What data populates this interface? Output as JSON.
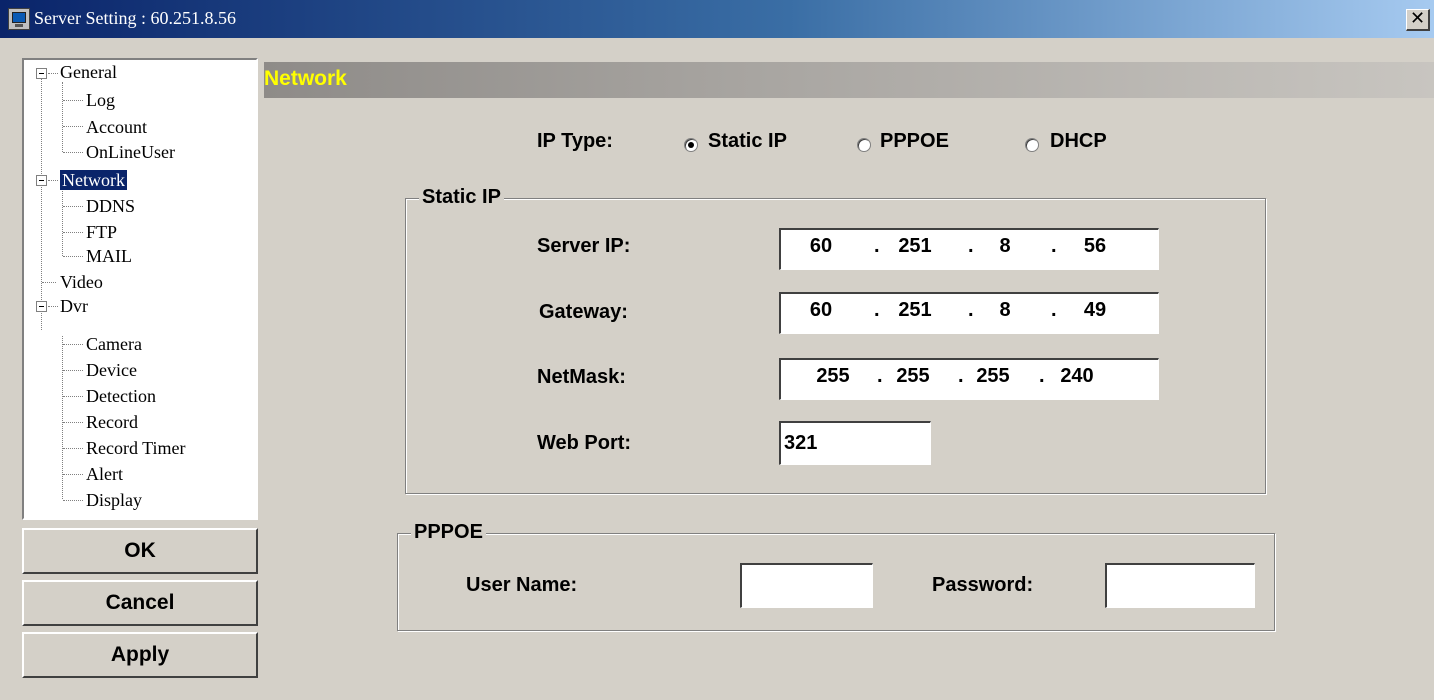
{
  "window": {
    "title": "Server Setting : 60.251.8.56",
    "close_glyph": "✕"
  },
  "tree": {
    "items": [
      {
        "label": "General",
        "level": 0,
        "expander": "minus"
      },
      {
        "label": "Log",
        "level": 1
      },
      {
        "label": "Account",
        "level": 1
      },
      {
        "label": "OnLineUser",
        "level": 1
      },
      {
        "label": "Network",
        "level": 0,
        "expander": "minus",
        "selected": true
      },
      {
        "label": "DDNS",
        "level": 1
      },
      {
        "label": "FTP",
        "level": 1
      },
      {
        "label": "MAIL",
        "level": 1
      },
      {
        "label": "Video",
        "level": 0
      },
      {
        "label": "Dvr",
        "level": 0,
        "expander": "minus"
      },
      {
        "label": "Camera",
        "level": 1
      },
      {
        "label": "Device",
        "level": 1
      },
      {
        "label": "Detection",
        "level": 1
      },
      {
        "label": "Record",
        "level": 1
      },
      {
        "label": "Record Timer",
        "level": 1
      },
      {
        "label": "Alert",
        "level": 1
      },
      {
        "label": "Display",
        "level": 1
      }
    ]
  },
  "buttons": {
    "ok": "OK",
    "cancel": "Cancel",
    "apply": "Apply"
  },
  "section": {
    "title": "Network"
  },
  "ip_type": {
    "label": "IP Type:",
    "options": [
      "Static IP",
      "PPPOE",
      "DHCP"
    ],
    "selected": "Static IP"
  },
  "static_ip": {
    "legend": "Static IP",
    "server_ip_label": "Server IP:",
    "server_ip": [
      "60",
      "251",
      "8",
      "56"
    ],
    "gateway_label": "Gateway:",
    "gateway": [
      "60",
      "251",
      "8",
      "49"
    ],
    "netmask_label": "NetMask:",
    "netmask": [
      "255",
      "255",
      "255",
      "240"
    ],
    "web_port_label": "Web Port:",
    "web_port": "321"
  },
  "pppoe": {
    "legend": "PPPOE",
    "user_name_label": "User Name:",
    "user_name": "",
    "password_label": "Password:",
    "password": ""
  },
  "colors": {
    "title_gradient_start": "#0a246a",
    "title_gradient_end": "#a6caf0",
    "section_title_color": "#ffff00",
    "tree_selected_bg": "#0a246a",
    "window_bg": "#d4d0c8"
  }
}
